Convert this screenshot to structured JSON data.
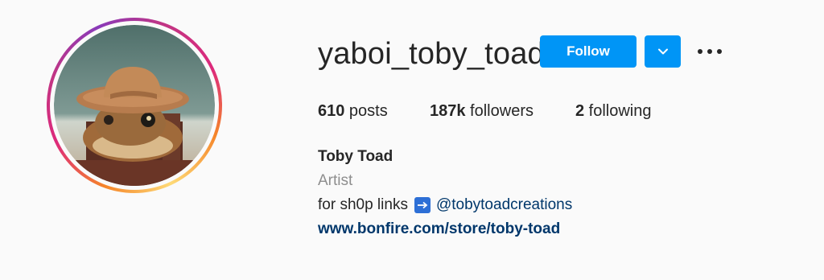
{
  "profile": {
    "username": "yaboi_toby_toad",
    "follow_label": "Follow",
    "dropdown_icon": "chevron-down-icon",
    "more_icon": "more-options-icon",
    "avatar_icon": "toad-in-cowboy-hat-photo"
  },
  "stats": {
    "posts_count": "610",
    "posts_label": " posts",
    "followers_count": "187k",
    "followers_label": " followers",
    "following_count": "2",
    "following_label": " following"
  },
  "bio": {
    "name": "Toby Toad",
    "category": "Artist",
    "shop_text": "for sh0p links",
    "arrow_icon": "right-arrow-icon",
    "mention": "@tobytoadcreations",
    "website": "www.bonfire.com/store/toby-toad"
  },
  "colors": {
    "primary_button": "#0095f6",
    "link": "#00376b",
    "muted_text": "#8e8e8e",
    "arrow_box": "#2d6fd6"
  }
}
